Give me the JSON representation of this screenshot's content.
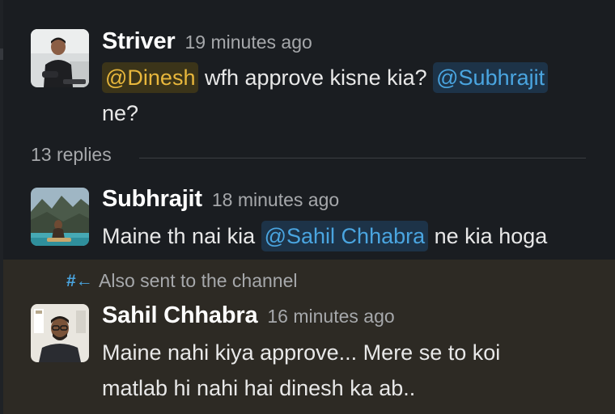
{
  "thread": {
    "parent": {
      "author": "Striver",
      "time": "19 minutes ago",
      "mention_1": "@Dinesh",
      "text_1": " wfh approve kisne kia? ",
      "mention_2": "@Subhrajit",
      "text_2": "ne?"
    },
    "replies_label": "13 replies",
    "reply_1": {
      "author": "Subhrajit",
      "time": "18 minutes ago",
      "text_1": "Maine th nai kia ",
      "mention_1": "@Sahil Chhabra",
      "text_2": " ne kia hoga"
    },
    "reply_2": {
      "channel_note_icon": "#←",
      "channel_note": "Also sent to the channel",
      "author": "Sahil Chhabra",
      "time": "16 minutes ago",
      "line_1": "Maine nahi kiya approve... Mere se to koi",
      "line_2": "matlab hi nahi hai dinesh ka ab.."
    }
  },
  "colors": {
    "background": "#1a1d21",
    "highlight_background": "#2d2a24",
    "mention_self": "#e8b73c",
    "mention_other": "#4aa5e0"
  },
  "icons": {
    "channel_note_icon": "sent-to-channel-icon"
  }
}
